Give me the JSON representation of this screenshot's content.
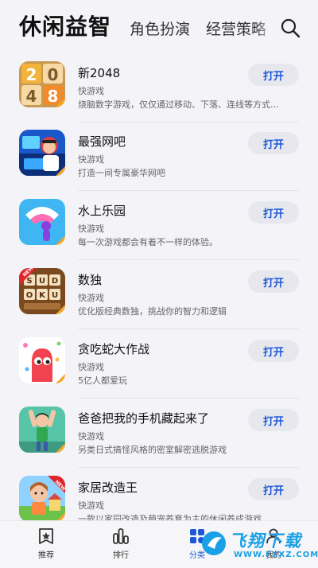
{
  "header": {
    "active_tab": "休闲益智",
    "tabs": [
      "角色扮演",
      "经营策略"
    ]
  },
  "apps": [
    {
      "title": "新2048",
      "category": "快游戏",
      "description": "烧脑数字游戏，仅仅通过移动、下落、连线等方式…",
      "button": "打开",
      "icon": "2048-tile-icon"
    },
    {
      "title": "最强网吧",
      "category": "快游戏",
      "description": "打造一间专属豪华网吧",
      "button": "打开",
      "icon": "internet-cafe-icon"
    },
    {
      "title": "水上乐园",
      "category": "快游戏",
      "description": "每一次游戏都会有着不一样的体验。",
      "button": "打开",
      "icon": "water-park-icon"
    },
    {
      "title": "数独",
      "category": "快游戏",
      "description": "优化版经典数独，挑战你的智力和逻辑",
      "button": "打开",
      "icon": "sudoku-icon",
      "icon_text": [
        "S",
        "U",
        "D",
        "O",
        "K",
        "U"
      ],
      "badge": "NEW"
    },
    {
      "title": "贪吃蛇大作战",
      "category": "快游戏",
      "description": "5亿人都爱玩",
      "button": "打开",
      "icon": "snake-icon"
    },
    {
      "title": "爸爸把我的手机藏起来了",
      "category": "快游戏",
      "description": "另类日式搞怪风格的密室解密逃脱游戏",
      "button": "打开",
      "icon": "phone-hidden-icon"
    },
    {
      "title": "家居改造王",
      "category": "快游戏",
      "description": "一款以家园改造及萌宠养育为主的休闲养成游戏",
      "button": "打开",
      "icon": "home-makeover-icon",
      "badge": "NEW"
    }
  ],
  "tile_2048": [
    "2",
    "0",
    "4",
    "8"
  ],
  "bottom_nav": [
    {
      "label": "推荐",
      "icon": "recommend-icon"
    },
    {
      "label": "排行",
      "icon": "ranking-icon"
    },
    {
      "label": "分类",
      "icon": "category-icon"
    },
    {
      "label": "我的",
      "icon": "profile-icon"
    }
  ],
  "watermark": {
    "text": "飞翔下载",
    "sub": "WWW.FXXZ.COM"
  },
  "colors": {
    "accent": "#1e57d6",
    "button_bg": "#e6e8ee",
    "background": "#f4f4f8"
  }
}
